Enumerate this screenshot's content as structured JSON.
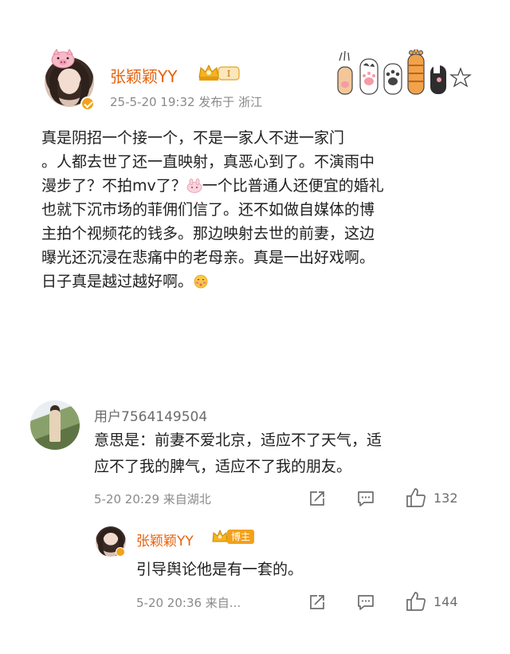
{
  "post": {
    "username": "张颖颖YY",
    "level_badge": "I",
    "meta": "25-5-20 19:32  发布于 浙江",
    "lines": [
      "真是阴招一个接一个，不是一家人不进一家门",
      "。人都去世了还一直映射，真恶心到了。不演雨中",
      "漫步了？不拍mv了？",
      "一个比普通人还便宜的婚礼",
      "也就下沉市场的菲佣们信了。还不如做自媒体的博",
      "主拍个视频花的钱多。那边映射去世的前妻，这边",
      "曝光还沉浸在悲痛中的老母亲。真是一出好戏啊。",
      "日子真是越过越好啊。"
    ]
  },
  "comment": {
    "username": "用户7564149504",
    "lines": [
      "意思是：前妻不爱北京，适应不了天气，适",
      "应不了我的脾气，适应不了我的朋友。"
    ],
    "meta": "5-20 20:29  来自湖北",
    "like_count": "132"
  },
  "reply": {
    "username": "张颖颖YY",
    "badge": "博主",
    "text": "引导舆论他是有一套的。",
    "meta": "5-20 20:36  来自...",
    "like_count": "144"
  },
  "colors": {
    "username_orange": "#e8620c",
    "meta_gray": "#8a8a8a",
    "badge_gold": "#f3a11b",
    "icon_gray": "#6d6d6d"
  },
  "icons": [
    "pig-sticker-icon",
    "crown-badge-icon",
    "cat-paw-stickers",
    "star-icon",
    "pink-rabbit-emoji",
    "blush-emoji",
    "share-icon",
    "comment-icon",
    "like-icon",
    "verified-icon"
  ]
}
